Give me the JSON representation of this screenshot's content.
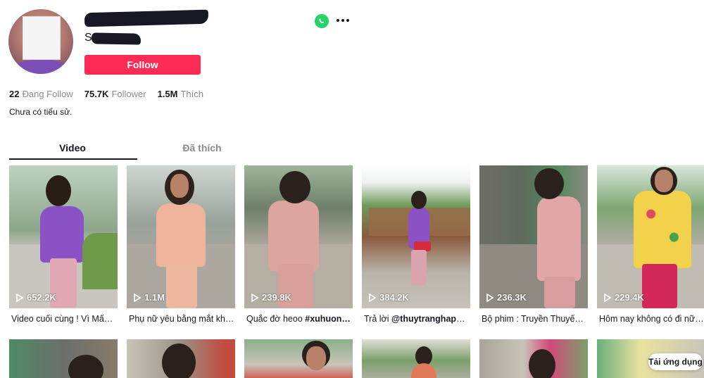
{
  "profile": {
    "username": "s",
    "nickname_initial": "S",
    "follow_label": "Follow",
    "bio": "Chưa có tiểu sử."
  },
  "stats": [
    {
      "value": "22",
      "label": "Đang Follow"
    },
    {
      "value": "75.7K",
      "label": "Follower"
    },
    {
      "value": "1.5M",
      "label": "Thích"
    }
  ],
  "tabs": [
    {
      "label": "Video",
      "active": true
    },
    {
      "label": "Đã thích",
      "active": false
    }
  ],
  "videos": [
    {
      "views": "652.2K",
      "caption": "Video cuối cùng ! Vì Mấy…",
      "caption_bold": ""
    },
    {
      "views": "1.1M",
      "caption": "Phụ nữ yêu bằng mắt kh…",
      "caption_bold": ""
    },
    {
      "views": "239.8K",
      "caption": "Quắc đờ heoo ",
      "caption_bold": "#xuhuon…"
    },
    {
      "views": "384.2K",
      "caption": "Trả lời ",
      "caption_bold": "@thuytranghapp…"
    },
    {
      "views": "236.3K",
      "caption": "Bộ phim : Truyền Thuyế…",
      "caption_bold": ""
    },
    {
      "views": "229.4K",
      "caption": "Hôm nay không có đi nữ…",
      "caption_bold": ""
    }
  ],
  "app_button": "Tải ứng dụng",
  "icons": {
    "share": "whatsapp-icon",
    "more": "more-icon",
    "play": "play-icon"
  },
  "colors": {
    "follow": "#fe2c55",
    "whatsapp": "#25d366",
    "text": "#161823",
    "muted": "#8a8b91"
  }
}
